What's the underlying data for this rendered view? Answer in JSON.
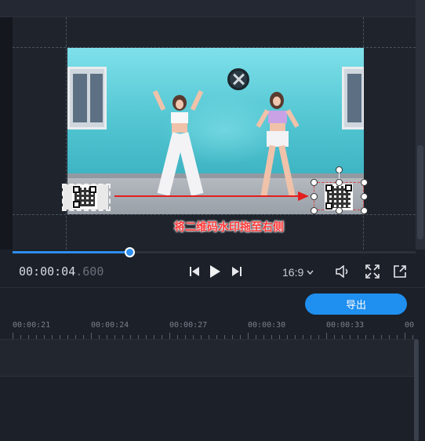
{
  "preview": {
    "caption": "将二维码水印拖至右侧"
  },
  "playback": {
    "timecode_main": "00:00:04",
    "timecode_ms": ".600",
    "progress": 0.29,
    "aspect_ratio": "16:9"
  },
  "toolbar": {
    "export_label": "导出"
  },
  "timeline": {
    "ticks": [
      "00:00:21",
      "00:00:24",
      "00:00:27",
      "00:00:30",
      "00:00:33",
      "00"
    ]
  },
  "colors": {
    "accent": "#1f8ff0",
    "annotation": "#e21e1e",
    "background": "#1c2029"
  },
  "icons": {
    "prev": "skip-previous-icon",
    "play": "play-icon",
    "next": "skip-next-icon",
    "volume": "volume-icon",
    "fullscreen": "fullscreen-icon",
    "popout": "popout-icon",
    "ratio_dropdown": "chevron-down-icon"
  }
}
